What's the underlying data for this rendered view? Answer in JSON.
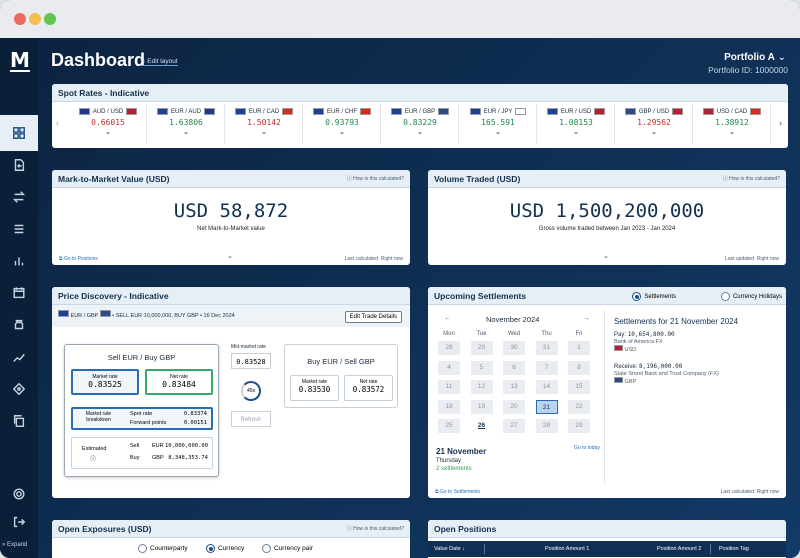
{
  "header": {
    "title": "Dashboard",
    "edit_layout": "Edit layout",
    "portfolio": "Portfolio A",
    "portfolio_id": "Portfolio ID: 1000000"
  },
  "sidebar": {
    "logo": "M",
    "expand": "Expand"
  },
  "spot": {
    "title": "Spot Rates - Indicative",
    "items": [
      {
        "pair": "AUD / USD",
        "rate": "0.66015",
        "dir": "down"
      },
      {
        "pair": "EUR / AUD",
        "rate": "1.63806",
        "dir": "up"
      },
      {
        "pair": "EUR / CAD",
        "rate": "1.50142",
        "dir": "down"
      },
      {
        "pair": "EUR / CHF",
        "rate": "0.93793",
        "dir": "up"
      },
      {
        "pair": "EUR / GBP",
        "rate": "0.83229",
        "dir": "up"
      },
      {
        "pair": "EUR / JPY",
        "rate": "165.591",
        "dir": "up"
      },
      {
        "pair": "EUR / USD",
        "rate": "1.08153",
        "dir": "up"
      },
      {
        "pair": "GBP / USD",
        "rate": "1.29562",
        "dir": "down"
      },
      {
        "pair": "USD / CAD",
        "rate": "1.38912",
        "dir": "up"
      }
    ]
  },
  "mtm": {
    "title": "Mark-to-Market Value (USD)",
    "how": "How is this calculated?",
    "value": "USD 58,872",
    "sub": "Net Mark-to-Market value",
    "link": "Go to Positions",
    "updated": "Last calculated: Right now"
  },
  "volume": {
    "title": "Volume Traded (USD)",
    "how": "How is this calculated?",
    "value": "USD 1,500,200,000",
    "sub": "Gross volume traded between Jan 2023 - Jan 2024",
    "updated": "Last updated: Right now"
  },
  "price": {
    "title": "Price Discovery - Indicative",
    "pair": "EUR / GBP",
    "trade": "SELL EUR 10,000,000, BUY GBP",
    "date": "16 Dec 2024",
    "edit": "Edit Trade Details",
    "left_title": "Sell EUR / Buy GBP",
    "market_rate_label": "Market rate",
    "market_rate": "0.83525",
    "net_rate_label": "Net rate",
    "net_rate": "0.83484",
    "breakdown_label": "Market rate breakdown",
    "spot_label": "Spot rate",
    "spot_rate": "0.83374",
    "fwd_label": "Forward points",
    "fwd_points": "0.00151",
    "estimated": "Estimated",
    "sell": "Sell",
    "sell_ccy": "EUR",
    "sell_amt": "10,000,000.00",
    "buy": "Buy",
    "buy_ccy": "GBP",
    "buy_amt": "8,348,353.74",
    "mid_label": "Mid-market rate",
    "mid_rate": "0.83528",
    "timer": "45s",
    "refresh": "Refresh",
    "right_title": "Buy EUR / Sell GBP",
    "r_market_rate": "0.83530",
    "r_net_rate": "0.83572"
  },
  "settle": {
    "title": "Upcoming Settlements",
    "opt1": "Settlements",
    "opt2": "Currency Holidays",
    "month": "November 2024",
    "dows": [
      "Mon",
      "Tue",
      "Wed",
      "Thu",
      "Fri"
    ],
    "rows": [
      [
        "28",
        "29",
        "30",
        "31",
        "1"
      ],
      [
        "4",
        "5",
        "6",
        "7",
        "8"
      ],
      [
        "11",
        "12",
        "13",
        "14",
        "15"
      ],
      [
        "18",
        "19",
        "20",
        "21",
        "22"
      ],
      [
        "25",
        "26",
        "27",
        "28",
        "29"
      ]
    ],
    "sel_date": "21 November",
    "sel_day": "Thursday",
    "count": "2 settlements",
    "goto_today": "Go to today",
    "right_title": "Settlements for 21 November 2024",
    "pay_label": "Pay:",
    "pay_amt": "10,654,800.00",
    "pay_bank": "Bank of America FX",
    "pay_ccy": "USD",
    "recv_label": "Receive:",
    "recv_amt": "8,196,000.00",
    "recv_bank": "State Street Bank and Trust Company (FX)",
    "recv_ccy": "GBP",
    "link": "Go to Settlements",
    "updated": "Last calculated: Right now"
  },
  "exposures": {
    "title": "Open Exposures (USD)",
    "how": "How is this calculated?",
    "opt1": "Counterparty",
    "opt2": "Currency",
    "opt3": "Currency pair"
  },
  "positions": {
    "title": "Open Positions",
    "cols": [
      "Value Date",
      "Position Amount 1",
      "Position Amount 2",
      "Position Tag"
    ]
  }
}
